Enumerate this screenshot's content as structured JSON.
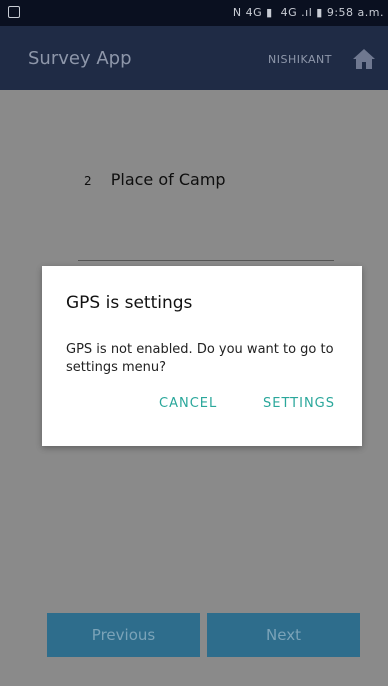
{
  "status_bar": {
    "right_text": "⁠N ⁠⁠4G ⁠⁠▮ ⁠ ⁠4G ⁠.ıl ▮ 9:58 a.m."
  },
  "app_bar": {
    "title": "Survey App",
    "user": "NISHIKANT",
    "home_icon": "home-icon"
  },
  "form": {
    "question_number": "2",
    "question_text": "Place of Camp"
  },
  "footer": {
    "previous_label": "Previous",
    "next_label": "Next"
  },
  "dialog": {
    "title": "GPS is settings",
    "message": "GPS is not enabled. Do you want to go to settings menu?",
    "cancel_label": "CANCEL",
    "settings_label": "SETTINGS"
  },
  "colors": {
    "accent": "#2aa79b",
    "app_bar": "#1f2b45",
    "button": "#2e6d8c"
  }
}
